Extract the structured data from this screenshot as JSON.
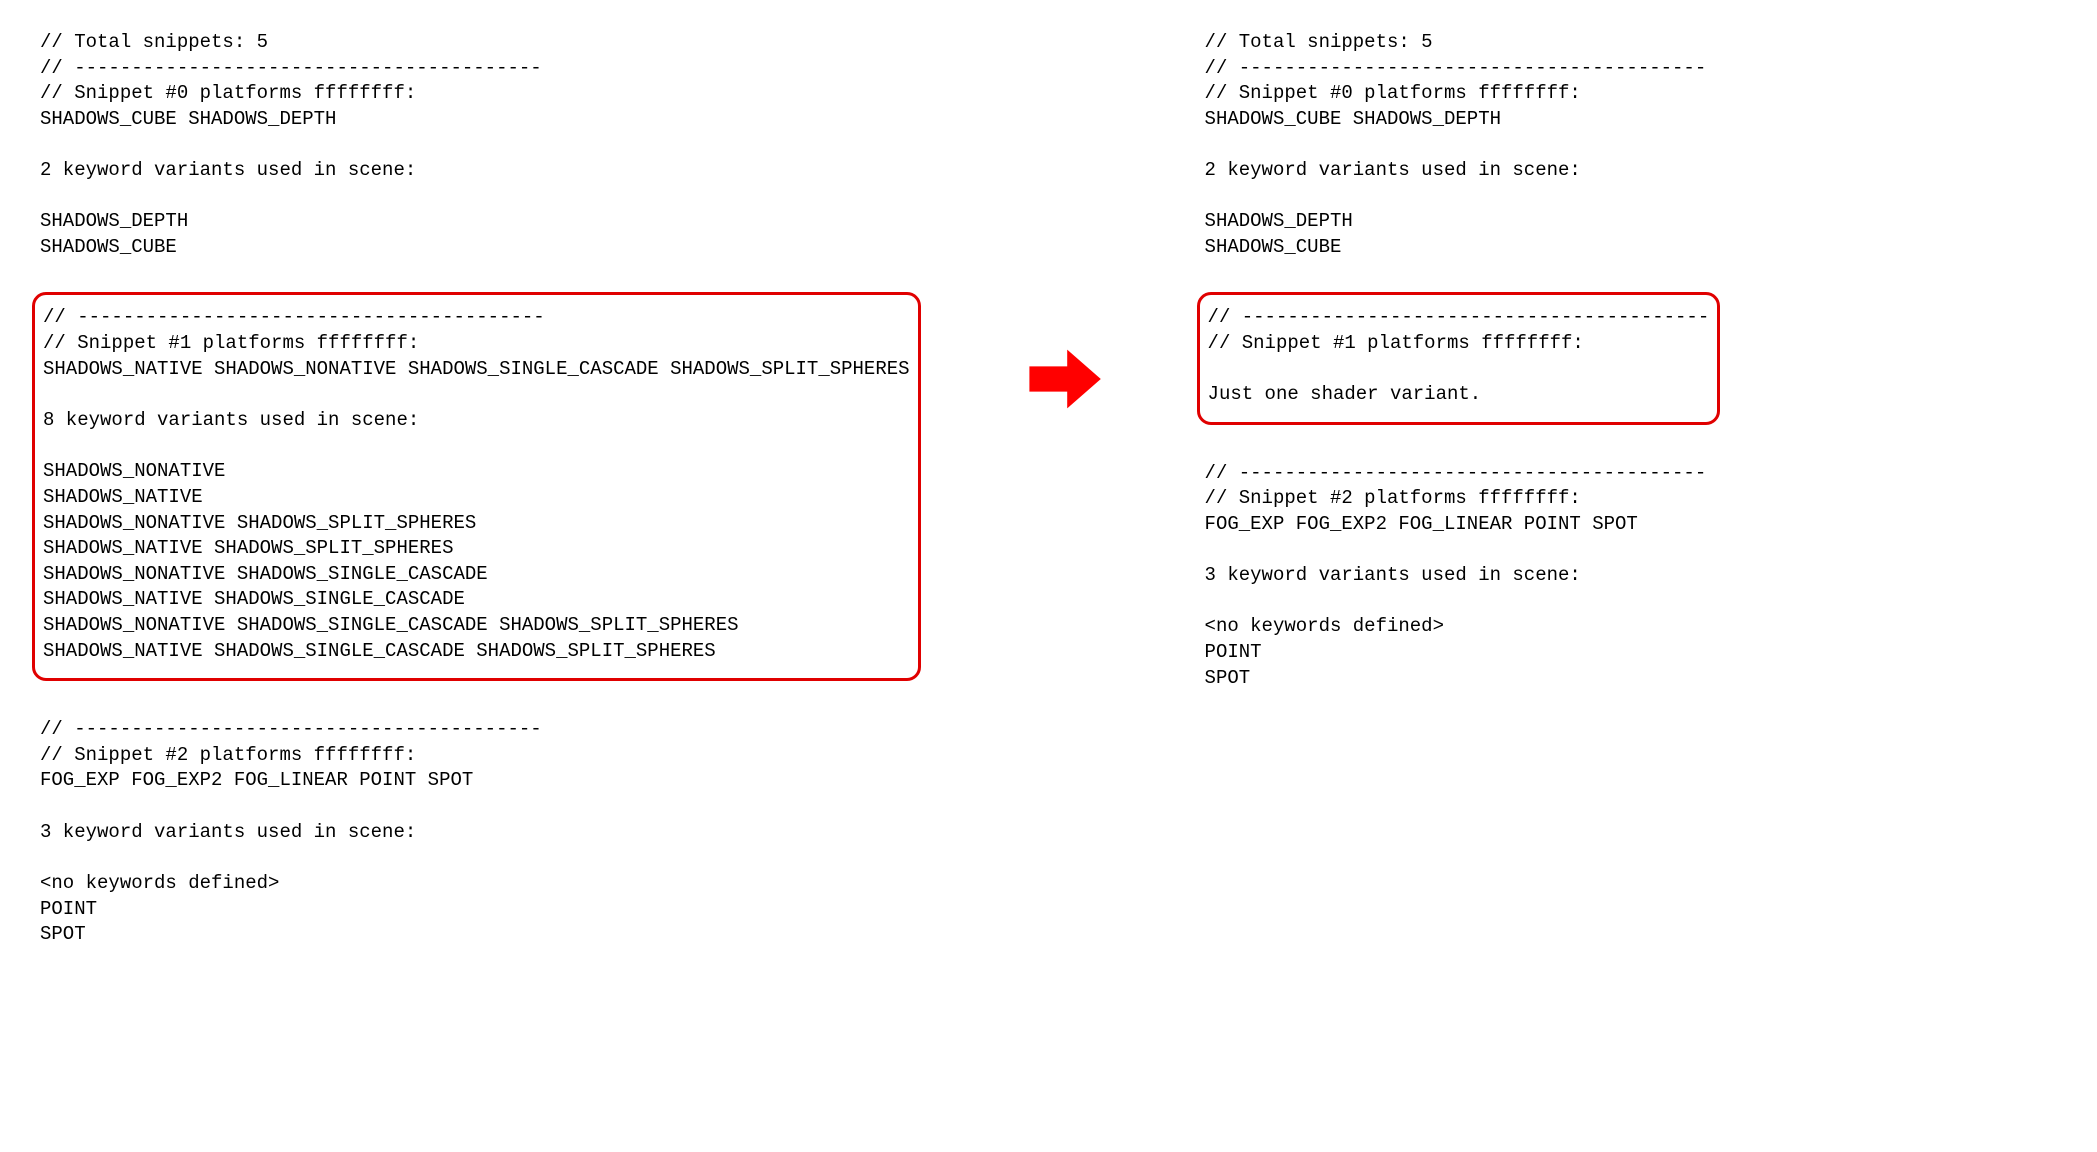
{
  "left": {
    "intro": {
      "lines": [
        "// Total snippets: 5",
        "// -----------------------------------------",
        "// Snippet #0 platforms ffffffff:",
        "SHADOWS_CUBE SHADOWS_DEPTH",
        "",
        "2 keyword variants used in scene:",
        "",
        "SHADOWS_DEPTH",
        "SHADOWS_CUBE"
      ]
    },
    "boxed1": {
      "lines": [
        "// -----------------------------------------",
        "// Snippet #1 platforms ffffffff:",
        "SHADOWS_NATIVE SHADOWS_NONATIVE SHADOWS_SINGLE_CASCADE SHADOWS_SPLIT_SPHERES",
        "",
        "8 keyword variants used in scene:",
        "",
        "SHADOWS_NONATIVE",
        "SHADOWS_NATIVE",
        "SHADOWS_NONATIVE SHADOWS_SPLIT_SPHERES",
        "SHADOWS_NATIVE SHADOWS_SPLIT_SPHERES",
        "SHADOWS_NONATIVE SHADOWS_SINGLE_CASCADE",
        "SHADOWS_NATIVE SHADOWS_SINGLE_CASCADE",
        "SHADOWS_NONATIVE SHADOWS_SINGLE_CASCADE SHADOWS_SPLIT_SPHERES",
        "SHADOWS_NATIVE SHADOWS_SINGLE_CASCADE SHADOWS_SPLIT_SPHERES"
      ]
    },
    "tail": {
      "lines": [
        "// -----------------------------------------",
        "// Snippet #2 platforms ffffffff:",
        "FOG_EXP FOG_EXP2 FOG_LINEAR POINT SPOT",
        "",
        "3 keyword variants used in scene:",
        "",
        "<no keywords defined>",
        "POINT",
        "SPOT"
      ]
    }
  },
  "right": {
    "intro": {
      "lines": [
        "// Total snippets: 5",
        "// -----------------------------------------",
        "// Snippet #0 platforms ffffffff:",
        "SHADOWS_CUBE SHADOWS_DEPTH",
        "",
        "2 keyword variants used in scene:",
        "",
        "SHADOWS_DEPTH",
        "SHADOWS_CUBE"
      ]
    },
    "boxed1": {
      "lines": [
        "// -----------------------------------------",
        "// Snippet #1 platforms ffffffff:",
        "",
        "Just one shader variant."
      ]
    },
    "tail": {
      "lines": [
        "// -----------------------------------------",
        "// Snippet #2 platforms ffffffff:",
        "FOG_EXP FOG_EXP2 FOG_LINEAR POINT SPOT",
        "",
        "3 keyword variants used in scene:",
        "",
        "<no keywords defined>",
        "POINT",
        "SPOT"
      ]
    }
  },
  "colors": {
    "highlight": "#e00000"
  }
}
